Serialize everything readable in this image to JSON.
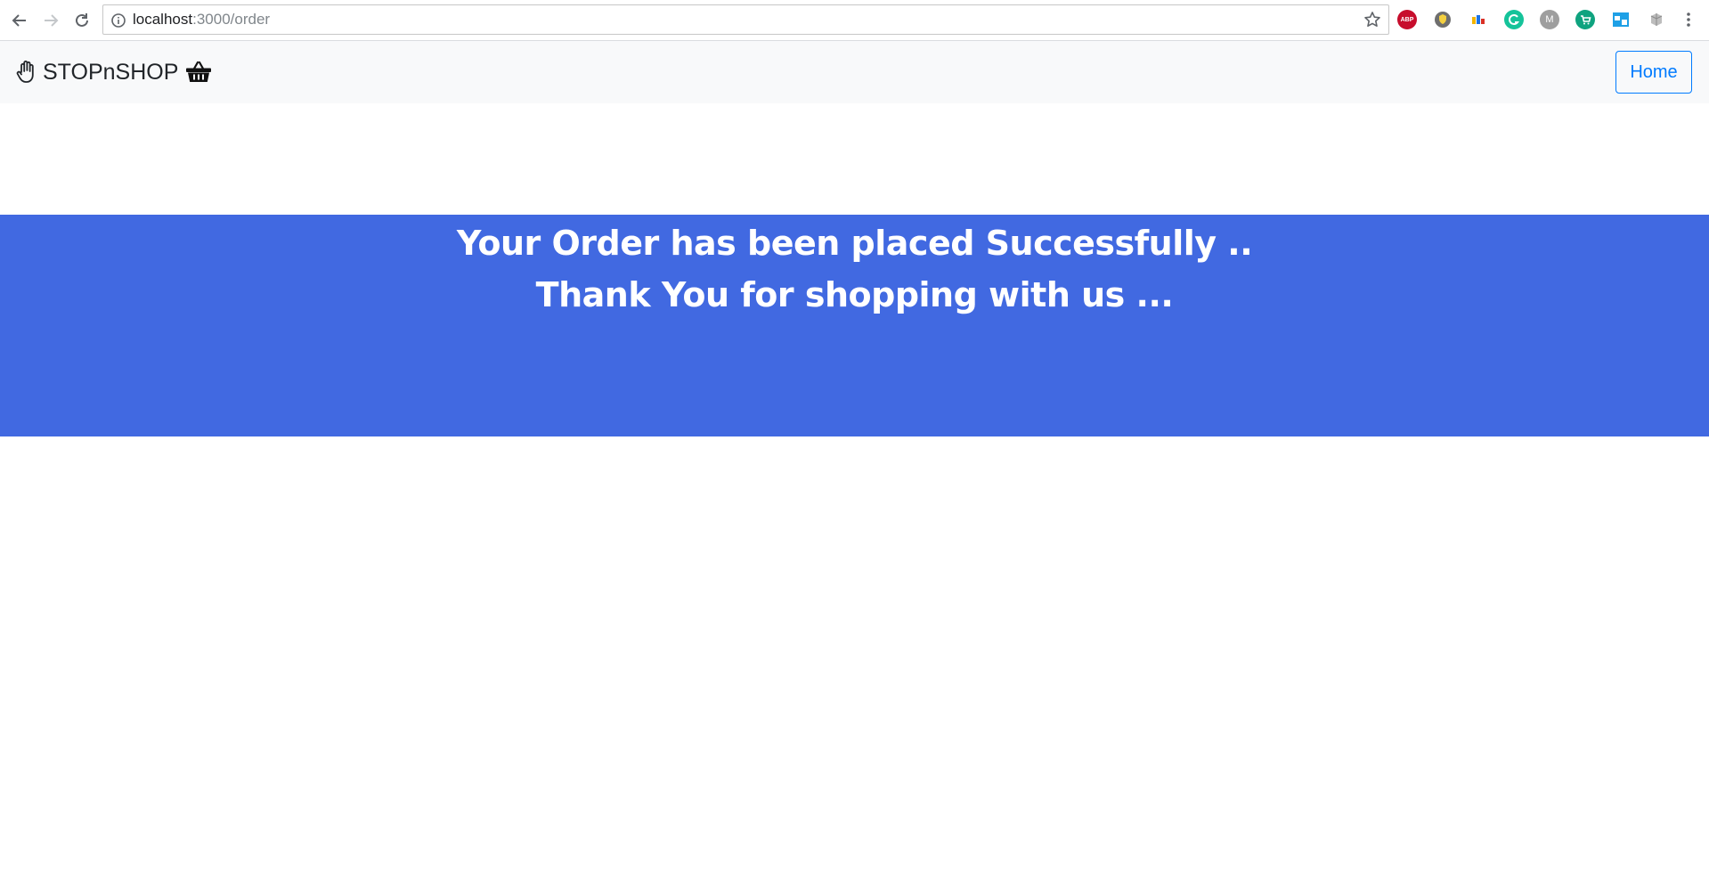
{
  "browser": {
    "url_host": "localhost",
    "url_path": ":3000/order",
    "icons": {
      "back": "back-arrow-icon",
      "forward": "forward-arrow-icon",
      "reload": "reload-icon",
      "info": "info-icon",
      "star": "bookmark-star-icon",
      "menu": "kebab-menu-icon"
    },
    "extensions": [
      {
        "name": "adblock-plus-icon",
        "label": "ABP",
        "color": "#c70d2c"
      },
      {
        "name": "shield-extension-icon",
        "color": "#6e6e6e"
      },
      {
        "name": "color-extension-icon",
        "color": "#f4b400"
      },
      {
        "name": "grammarly-icon",
        "color": "#15c39a"
      },
      {
        "name": "m-extension-icon",
        "label": "M",
        "color": "#9e9e9e"
      },
      {
        "name": "cart-extension-icon",
        "color": "#0fa37f"
      },
      {
        "name": "window-extension-icon",
        "color": "#1ea0e6"
      },
      {
        "name": "puzzle-extension-icon",
        "color": "#9e9e9e"
      }
    ]
  },
  "navbar": {
    "brand_name": "STOPnSHOP",
    "home_label": "Home",
    "colors": {
      "background": "#f8f9fa",
      "button": "#007bff"
    }
  },
  "banner": {
    "line1": "Your Order has been placed Successfully ..",
    "line2": "Thank You for shopping with us ...",
    "background": "#4169e1"
  }
}
